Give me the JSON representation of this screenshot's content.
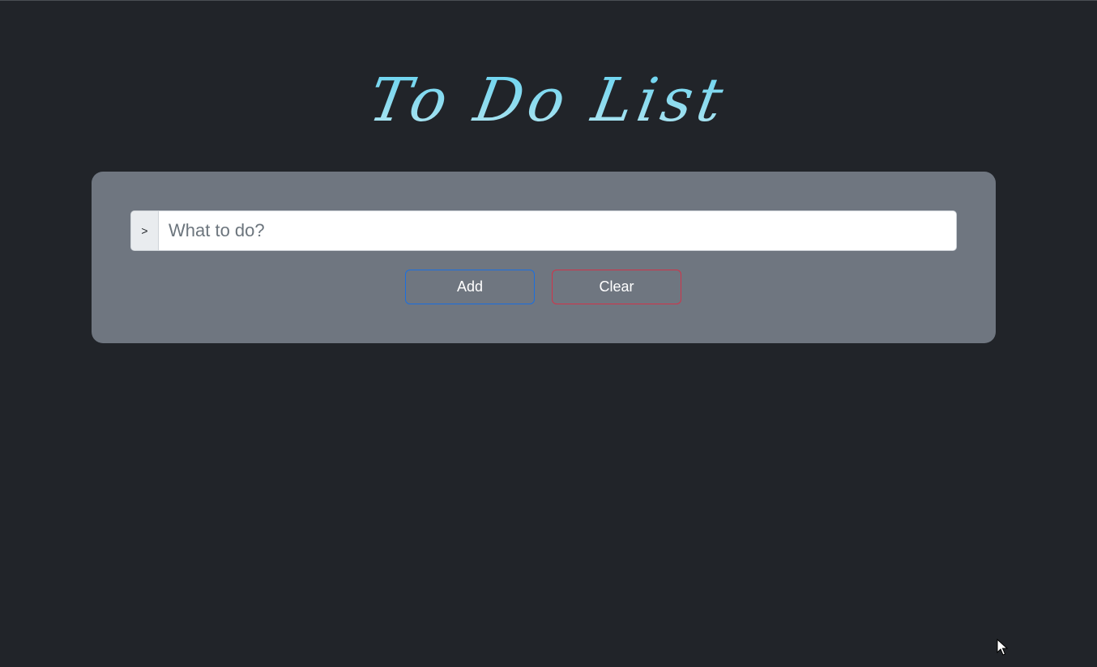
{
  "header": {
    "title": "To Do List"
  },
  "form": {
    "prefix": ">",
    "input_value": "",
    "input_placeholder": "What to do?",
    "add_label": "Add",
    "clear_label": "Clear"
  },
  "colors": {
    "background": "#212429",
    "panel": "#6f7680",
    "title_accent": "#5cd2f2",
    "add_border": "#1a6fe0",
    "clear_border": "#d0344a"
  },
  "icons": {
    "cursor": "mouse-pointer-icon"
  }
}
